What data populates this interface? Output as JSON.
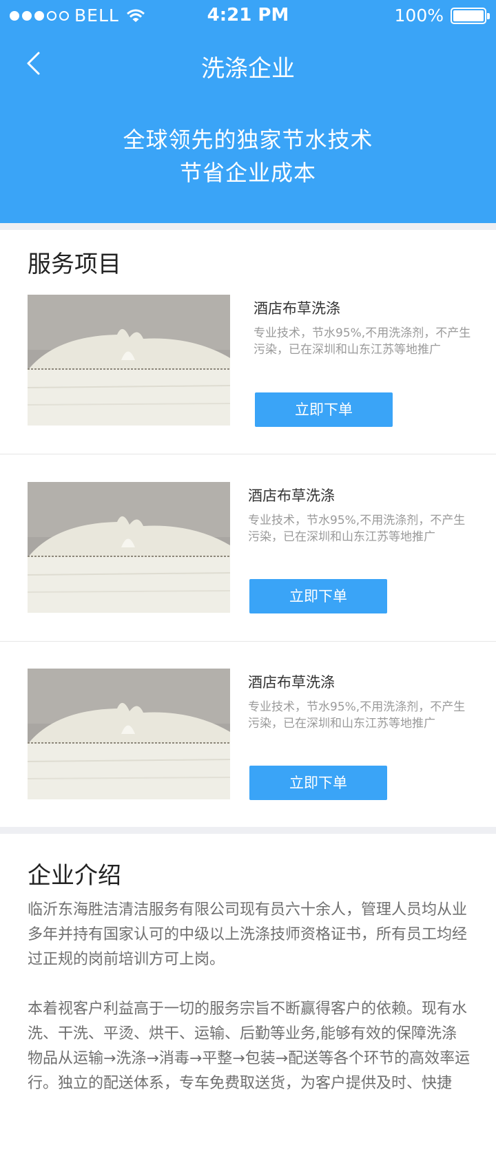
{
  "status_bar": {
    "carrier": "BELL",
    "time": "4:21 PM",
    "battery": "100%"
  },
  "nav": {
    "title": "洗涤企业"
  },
  "hero": {
    "line1": "全球领先的独家节水技术",
    "line2": "节省企业成本"
  },
  "services": {
    "title": "服务项目",
    "items": [
      {
        "name": "酒店布草洗涤",
        "desc": "专业技术，节水95%,不用洗涤剂，不产生污染，已在深圳和山东江苏等地推广",
        "button": "立即下单"
      },
      {
        "name": "酒店布草洗涤",
        "desc": "专业技术，节水95%,不用洗涤剂，不产生污染，已在深圳和山东江苏等地推广",
        "button": "立即下单"
      },
      {
        "name": "酒店布草洗涤",
        "desc": "专业技术，节水95%,不用洗涤剂，不产生污染，已在深圳和山东江苏等地推广",
        "button": "立即下单"
      }
    ]
  },
  "intro": {
    "title": "企业介绍",
    "para1": "临沂东海胜洁清洁服务有限公司现有员六十余人，管理人员均从业多年并持有国家认可的中级以上洗涤技师资格证书，所有员工均经过正规的岗前培训方可上岗。",
    "para2": "本着视客户利益高于一切的服务宗旨不断赢得客户的依赖。现有水洗、干洗、平烫、烘干、运输、后勤等业务,能够有效的保障洗涤物品从运输→洗涤→消毒→平整→包装→配送等各个环节的高效率运行。独立的配送体系，专车免费取送货，为客户提供及时、快捷"
  },
  "colors": {
    "accent": "#3aa4f7",
    "divider": "#eeeff3"
  }
}
